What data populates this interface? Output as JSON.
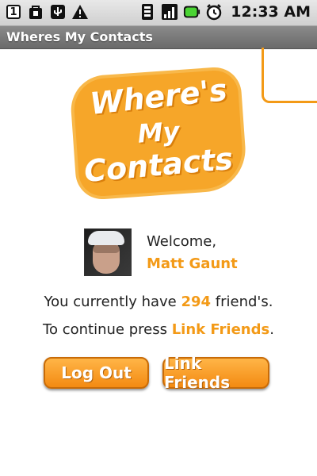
{
  "status_bar": {
    "sim_badge": "1",
    "time": "12:33 AM",
    "icons": [
      "sim-icon",
      "bag-icon",
      "usb-icon",
      "warning-icon",
      "signal-icon",
      "signal-bars-icon",
      "battery-icon",
      "alarm-icon"
    ]
  },
  "app": {
    "title": "Wheres My Contacts"
  },
  "logo": {
    "line1": "Where's",
    "line2": "My",
    "line3": "Contacts"
  },
  "welcome": {
    "greeting": "Welcome,",
    "user_name": "Matt Gaunt"
  },
  "info": {
    "friends_prefix": "You currently have ",
    "friends_count": "294",
    "friends_suffix": " friend's.",
    "continue_prefix": "To continue press ",
    "continue_link": "Link Friends",
    "continue_suffix": "."
  },
  "buttons": {
    "logout": "Log Out",
    "link_friends": "Link Friends"
  },
  "colors": {
    "accent": "#f39a17",
    "title_bar": "#7a7a7a"
  }
}
